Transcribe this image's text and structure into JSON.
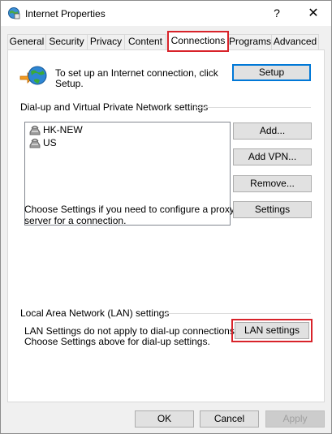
{
  "window": {
    "title": "Internet Properties",
    "help_label": "?",
    "close_label": "✕"
  },
  "tabs": [
    {
      "label": "General"
    },
    {
      "label": "Security"
    },
    {
      "label": "Privacy"
    },
    {
      "label": "Content"
    },
    {
      "label": "Connections",
      "active": true,
      "highlighted": true
    },
    {
      "label": "Programs"
    },
    {
      "label": "Advanced"
    }
  ],
  "setup_section": {
    "text_line1": "To set up an Internet connection, click",
    "text_line2": "Setup.",
    "setup_button": "Setup"
  },
  "dialup_section": {
    "heading": "Dial-up and Virtual Private Network settings",
    "connections": [
      {
        "name": "HK-NEW"
      },
      {
        "name": "US"
      }
    ],
    "add_button": "Add...",
    "add_vpn_button": "Add VPN...",
    "remove_button": "Remove...",
    "proxy_text_line1": "Choose Settings if you need to configure a proxy",
    "proxy_text_line2": "server for a connection.",
    "settings_button": "Settings"
  },
  "lan_section": {
    "heading": "Local Area Network (LAN) settings",
    "text_line1": "LAN Settings do not apply to dial-up connections.",
    "text_line2": "Choose Settings above for dial-up settings.",
    "lan_button": "LAN settings"
  },
  "footer": {
    "ok_button": "OK",
    "cancel_button": "Cancel",
    "apply_button": "Apply"
  },
  "colors": {
    "highlight": "#d8232a",
    "default_button_border": "#0078d7"
  },
  "icons": {
    "title": "internet-options-icon",
    "setup": "globe-connect-icon",
    "connection": "dialup-connection-icon"
  }
}
